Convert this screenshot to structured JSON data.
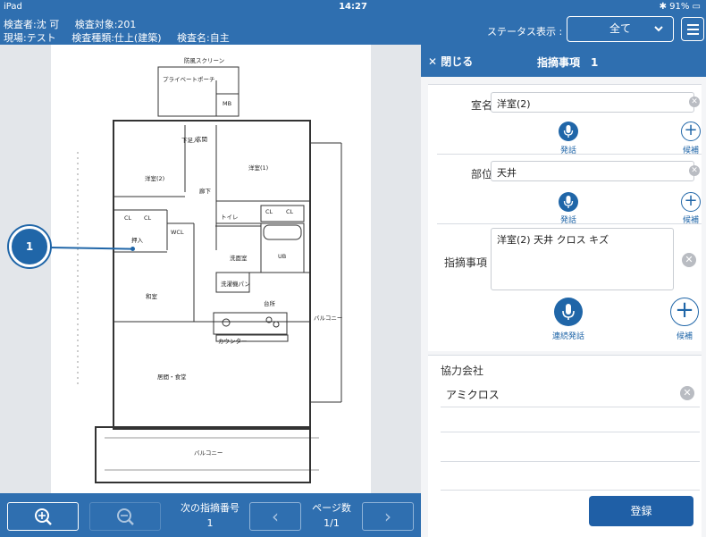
{
  "status_bar": {
    "device": "iPad",
    "time": "14:27",
    "battery": "91%"
  },
  "header": {
    "inspector": "検査者:沈 可",
    "target": "検査対象:201",
    "site": "現場:テスト",
    "type": "検査種類:仕上(建築)",
    "name": "検査名:自主",
    "status_label": "ステータス表示 :",
    "status_value": "全て"
  },
  "floor_plan": {
    "marker_number": "1",
    "rooms": {
      "screen": "防風スクリーン",
      "porch": "プライベートポーチ",
      "mb": "MB",
      "entrance": "玄関",
      "shoes": "下足入",
      "western2": "洋室(2)",
      "western1": "洋室(1)",
      "hallway": "廊下",
      "toilet": "トイレ",
      "cl1": "CL",
      "cl2": "CL",
      "cl3": "CL",
      "cl4": "CL",
      "oshiire": "押入",
      "wcl": "WCL",
      "washroom": "洗面室",
      "ub": "UB",
      "japanese": "和室",
      "kitchen": "台所",
      "counter": "カウンター",
      "washer": "洗濯機パン",
      "living": "居間・食堂",
      "balcony_r": "バルコニー",
      "balcony_b": "バルコニー"
    }
  },
  "bottom_bar": {
    "next_label": "次の指摘番号",
    "next_value": "1",
    "page_label": "ページ数",
    "page_value": "1/1"
  },
  "panel": {
    "close_label": "閉じる",
    "title": "指摘事項　1",
    "room": {
      "label": "室名",
      "value": "洋室(2)"
    },
    "part": {
      "label": "部位",
      "value": "天井"
    },
    "issue": {
      "label": "指摘事項",
      "value": "洋室(2) 天井 クロス キズ"
    },
    "voice_label": "発話",
    "candidate_label": "候補",
    "continuous_voice_label": "連続発話",
    "company": {
      "label": "協力会社",
      "value": "アミクロス"
    },
    "register_label": "登録"
  }
}
